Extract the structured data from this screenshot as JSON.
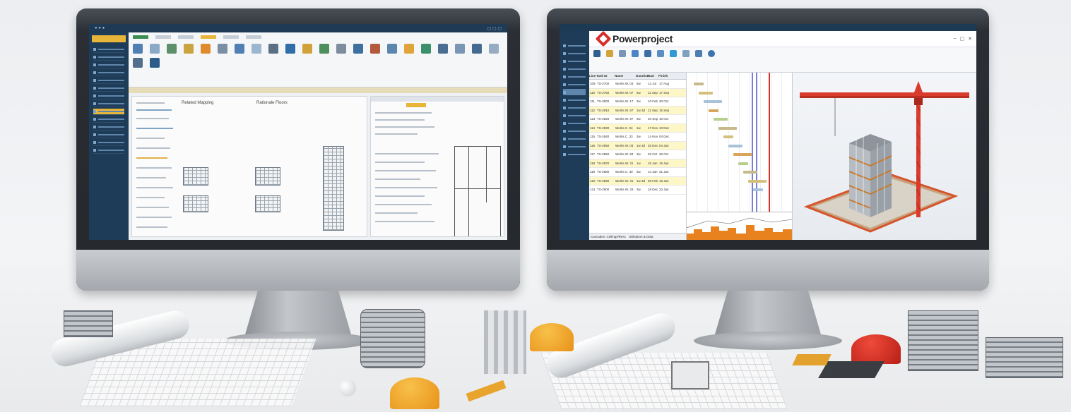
{
  "left_app": {
    "title_bar_text": "",
    "sidebar_items": [
      "",
      "",
      "",
      "",
      "",
      "",
      "",
      "",
      "",
      "",
      "",
      "",
      "",
      "",
      ""
    ],
    "panel_headings": [
      "Related Mapping",
      "Rationale Floors"
    ]
  },
  "right_app": {
    "brand": "Powerproject",
    "window_controls": [
      "–",
      "▢",
      "✕"
    ],
    "table_headers": [
      "Line",
      "Task ID",
      "Name",
      "Duration",
      "Start",
      "Finish"
    ],
    "rows": [
      {
        "line": "109",
        "id": "TS-2700",
        "name": "Works W. 03",
        "dur": "5w",
        "start": "13 Jul",
        "finish": "17 Aug"
      },
      {
        "line": "110",
        "id": "TS-2750",
        "name": "Works W. 07",
        "dur": "5w",
        "start": "11 Sep",
        "finish": "17 Sep"
      },
      {
        "line": "111",
        "id": "TS-2800",
        "name": "Works W. 17",
        "dur": "3w",
        "start": "10 Feb",
        "finish": "30 Oct"
      },
      {
        "line": "112",
        "id": "TS-2810",
        "name": "Works W. 87",
        "dur": "1w 3d",
        "start": "11 Sep",
        "finish": "15 Sep"
      },
      {
        "line": "113",
        "id": "TS-2820",
        "name": "Works W. 97",
        "dur": "3w",
        "start": "20 Sep",
        "finish": "16 Oct"
      },
      {
        "line": "114",
        "id": "TS-2830",
        "name": "Works C. 04",
        "dur": "1w",
        "start": "17 Nov",
        "finish": "10 Dec"
      },
      {
        "line": "115",
        "id": "TS-2840",
        "name": "Works C. 33",
        "dur": "3w",
        "start": "14 Nov",
        "finish": "04 Dec"
      },
      {
        "line": "116",
        "id": "TS-2850",
        "name": "Works W. 03",
        "dur": "1w 3d",
        "start": "03 Dec",
        "finish": "04 Jan"
      },
      {
        "line": "117",
        "id": "TS-2860",
        "name": "Works W. 93",
        "dur": "3w",
        "start": "03 Oct",
        "finish": "26 Oct"
      },
      {
        "line": "118",
        "id": "TS-2870",
        "name": "Works W. 31",
        "dur": "1w",
        "start": "15 Jan",
        "finish": "18 Jan"
      },
      {
        "line": "119",
        "id": "TS-2880",
        "name": "Works C. 30",
        "dur": "3w",
        "start": "14 Jan",
        "finish": "31 Jan"
      },
      {
        "line": "120",
        "id": "TS-2890",
        "name": "Works W. 31",
        "dur": "1w 3d",
        "start": "06 Feb",
        "finish": "19 Jan"
      },
      {
        "line": "121",
        "id": "TS-2900",
        "name": "Works W. 33",
        "dur": "3w",
        "start": "18 Dec",
        "finish": "23 Jan"
      }
    ],
    "footer_tabs": [
      "Cascades, Ceilings/Resc",
      "Utilisation & Data"
    ]
  },
  "colors": {
    "sidebar": "#1e3b57",
    "accent_yellow": "#e7b53a",
    "brand_red": "#d6302c",
    "crane_red": "#d93b2c",
    "gantt_orange": "#e8821e"
  }
}
